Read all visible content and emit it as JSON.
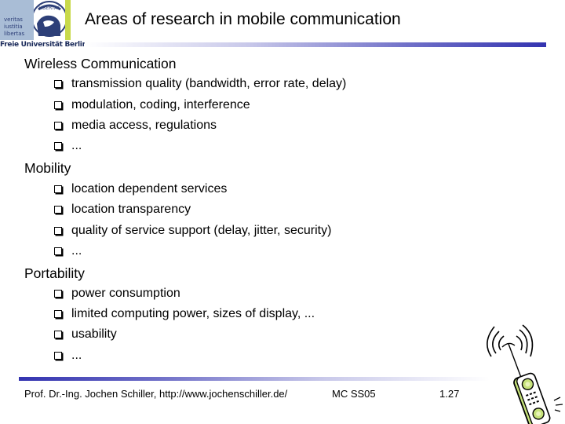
{
  "logo": {
    "motto": [
      "veritas",
      "iustitia",
      "libertas"
    ],
    "seal_text": "LIBERTAS",
    "name": "Freie Universität Berlin"
  },
  "title": "Areas of research in mobile communication",
  "sections": [
    {
      "heading": "Wireless Communication",
      "items": [
        "transmission quality (bandwidth, error rate, delay)",
        "modulation, coding, interference",
        "media access, regulations",
        "..."
      ]
    },
    {
      "heading": "Mobility",
      "items": [
        "location dependent services",
        "location transparency",
        "quality of service support (delay, jitter, security)",
        "..."
      ]
    },
    {
      "heading": "Portability",
      "items": [
        "power consumption",
        "limited computing power, sizes of display, ...",
        "usability",
        "..."
      ]
    }
  ],
  "footer": {
    "author": "Prof. Dr.-Ing. Jochen Schiller, http://www.jochenschiller.de/",
    "course": "MC SS05",
    "page": "1.27"
  },
  "colors": {
    "accent_blue": "#3333b0",
    "logo_blue": "#a9bdd6",
    "logo_green": "#c8d94a",
    "phone_green": "#c6e27a"
  },
  "icons": {
    "bullet": "hollow-square-bullet-icon",
    "phone": "mobile-phone-signal-icon"
  }
}
